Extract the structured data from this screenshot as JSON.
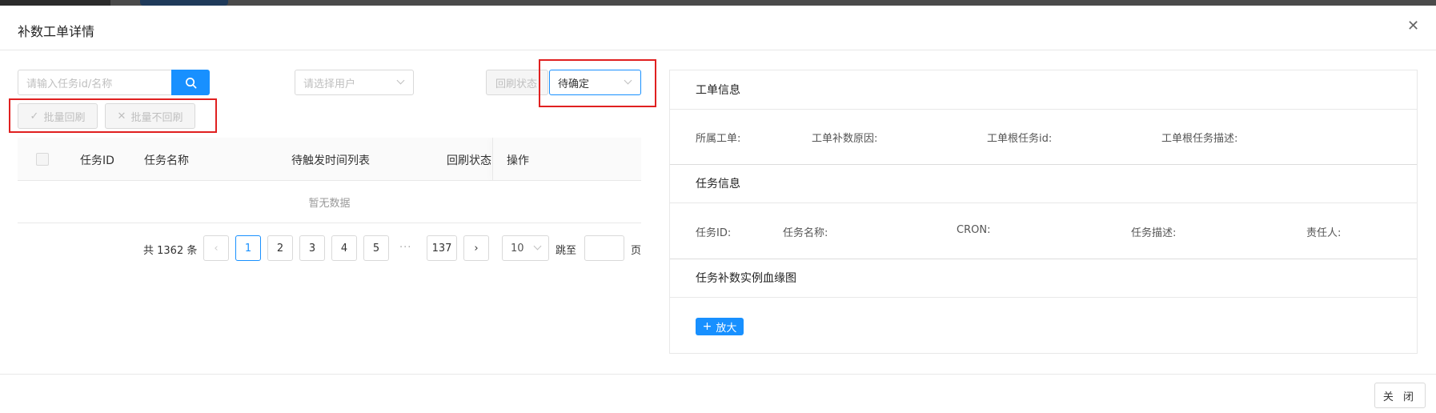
{
  "modal": {
    "title": "补数工单详情",
    "close_icon": "close-icon"
  },
  "filters": {
    "search_placeholder": "请输入任务id/名称",
    "user_placeholder": "请选择用户",
    "status_label": "回刷状态",
    "status_value": "待确定"
  },
  "batch": {
    "refresh_label": "批量回刷",
    "no_refresh_label": "批量不回刷"
  },
  "table": {
    "columns": [
      "任务ID",
      "任务名称",
      "待触发时间列表",
      "回刷状态",
      "操作"
    ],
    "empty_text": "暂无数据"
  },
  "pagination": {
    "total_text": "共 1362 条",
    "pages": [
      "1",
      "2",
      "3",
      "4",
      "5"
    ],
    "ellipsis": "···",
    "last_page": "137",
    "current": "1",
    "page_size": "10",
    "jump_label": "跳至",
    "page_suffix": "页"
  },
  "detail": {
    "ticket_section": "工单信息",
    "ticket_fields": [
      "所属工单:",
      "工单补数原因:",
      "工单根任务id:",
      "工单根任务描述:"
    ],
    "task_section": "任务信息",
    "task_fields": [
      "任务ID:",
      "任务名称:",
      "CRON:",
      "任务描述:",
      "责任人:"
    ],
    "lineage_section": "任务补数实例血缘图",
    "zoom_label": "放大"
  },
  "footer": {
    "close_label": "关 闭"
  },
  "colors": {
    "primary": "#1890ff",
    "highlight": "#e02020"
  }
}
